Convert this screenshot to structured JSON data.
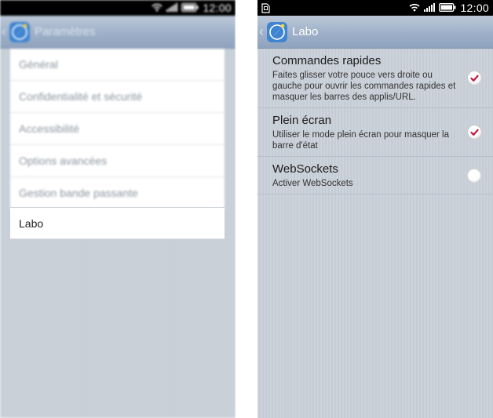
{
  "left_screen": {
    "status_time": "12:00",
    "title": "Paramètres",
    "menu": [
      {
        "label": "Général"
      },
      {
        "label": "Confidentialité et sécurité"
      },
      {
        "label": "Accessibilité"
      },
      {
        "label": "Options avancées"
      },
      {
        "label": "Gestion bande passante"
      },
      {
        "label": "Labo"
      }
    ]
  },
  "right_screen": {
    "status_time": "12:00",
    "title": "Labo",
    "settings": [
      {
        "title": "Commandes rapides",
        "description": "Faites glisser votre pouce vers droite ou gauche pour ouvrir les commandes rapides et masquer les barres des applis/URL.",
        "checked": true
      },
      {
        "title": "Plein écran",
        "description": "Utiliser le mode plein écran pour masquer la barre d'état",
        "checked": true
      },
      {
        "title": "WebSockets",
        "description": "Activer WebSockets",
        "checked": false
      }
    ]
  },
  "colors": {
    "check_mark": "#c0143c",
    "action_bar": "#9eb0c8",
    "status_bar": "#000000"
  },
  "icons": [
    "back-chevron",
    "browser-logo",
    "wifi-icon",
    "signal-icon",
    "battery-icon",
    "sd-card-icon",
    "checkbox-checked-icon",
    "checkbox-unchecked-icon"
  ]
}
